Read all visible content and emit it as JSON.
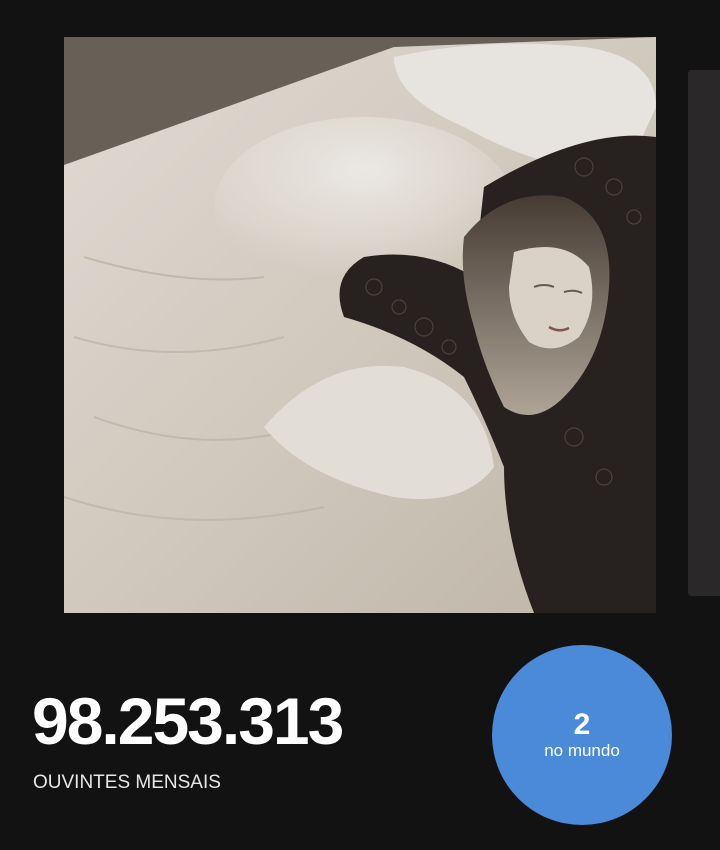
{
  "artist": {
    "cover_image": {
      "description_icon": "album-cover-photo",
      "palette": [
        "#f1ede6",
        "#d8d0c4",
        "#8a8075",
        "#2a2421"
      ]
    },
    "monthly_listeners": "98.253.313",
    "monthly_listeners_label": "OUVINTES MENSAIS"
  },
  "rank": {
    "position": "2",
    "caption": "no mundo",
    "color": "#4a8ad9"
  },
  "colors": {
    "background": "#121212",
    "text": "#ffffff"
  }
}
